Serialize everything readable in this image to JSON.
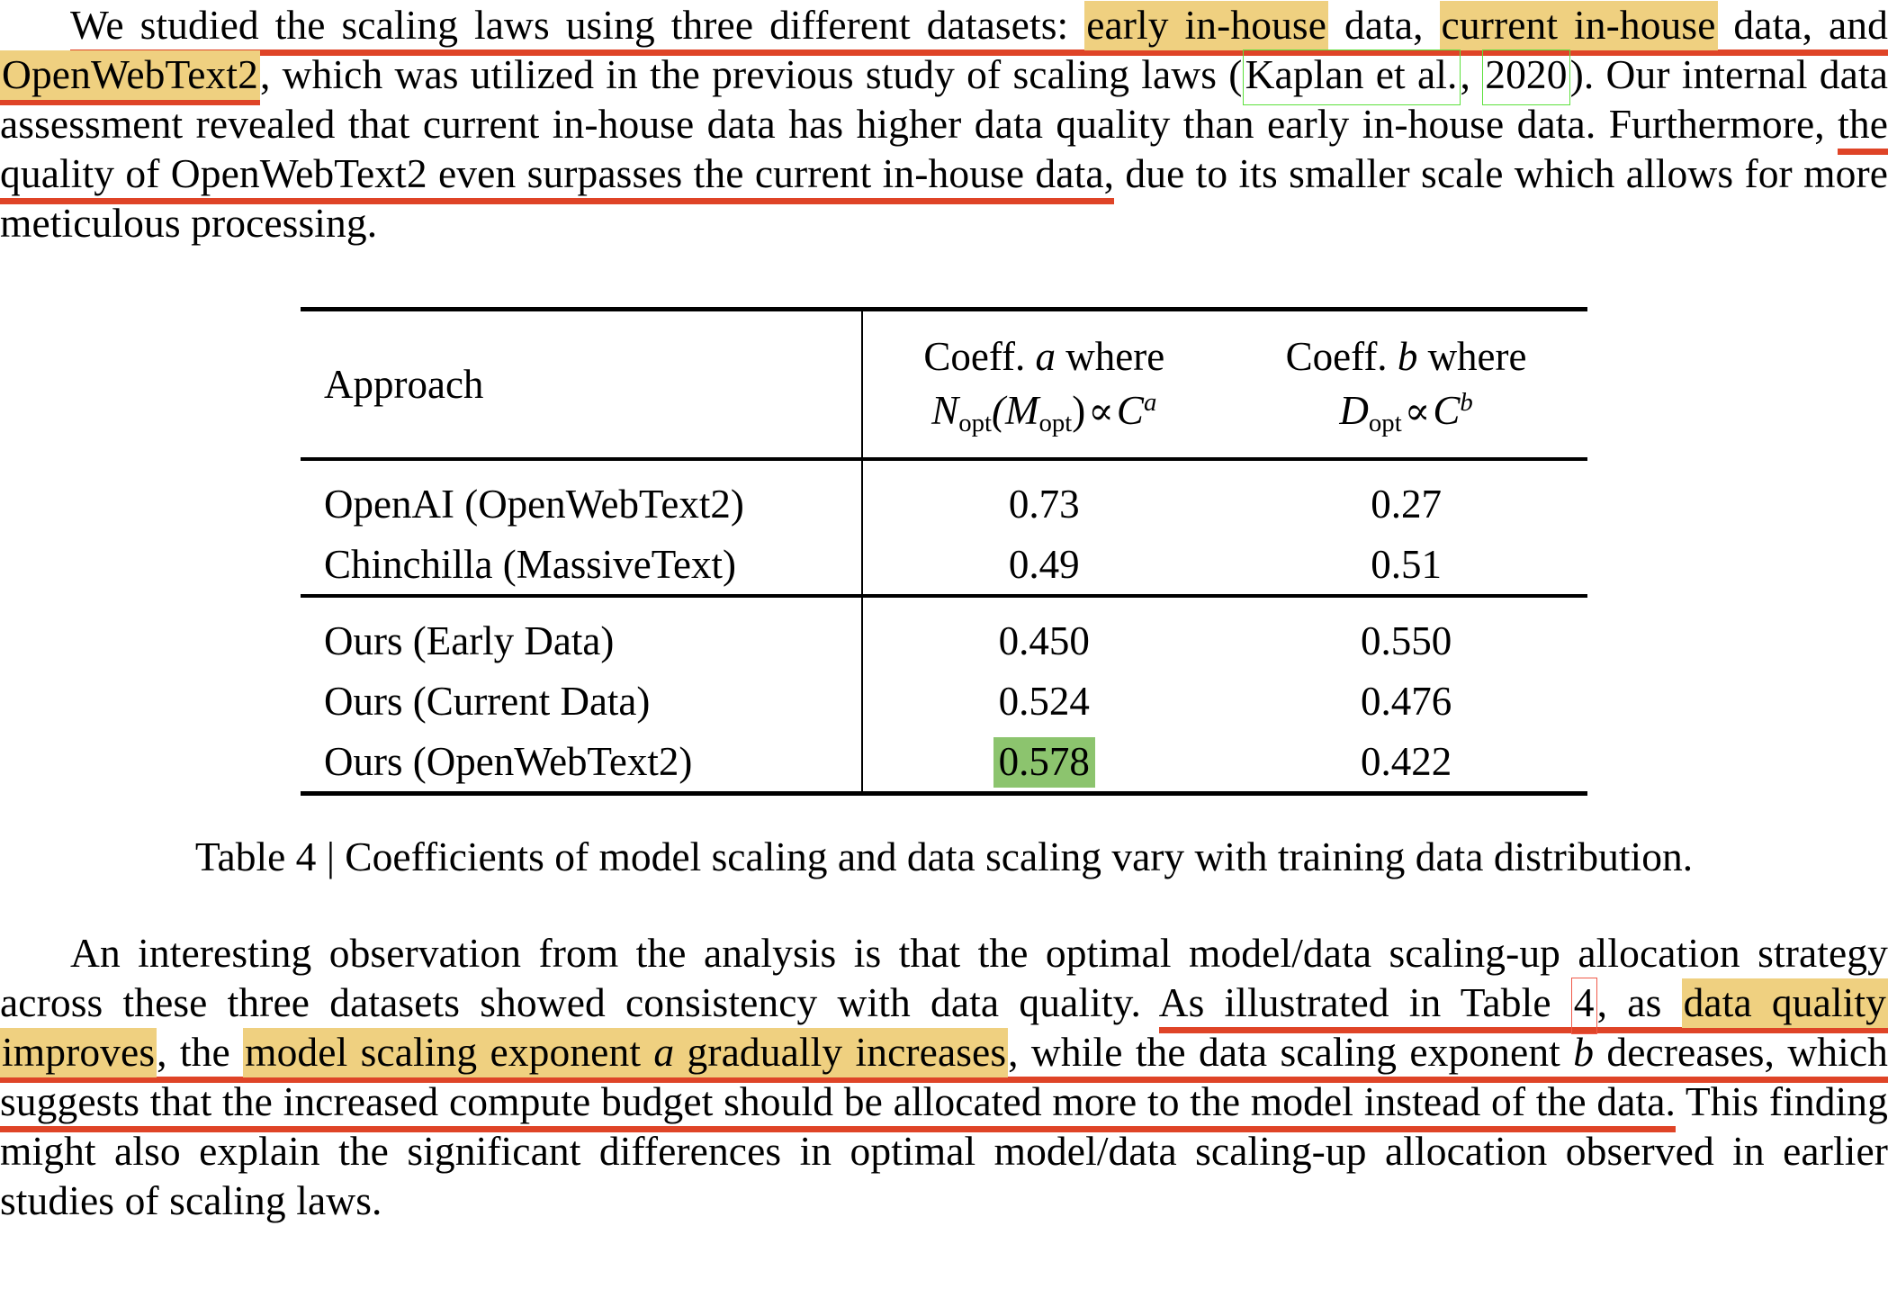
{
  "paragraph_1": {
    "segments": [
      {
        "text": "We studied the scaling laws using three different datasets: ",
        "style": "underline"
      },
      {
        "text": "early in-house",
        "style": "highlight-underline"
      },
      {
        "text": " data, ",
        "style": "underline"
      },
      {
        "text": "current in-house",
        "style": "highlight-underline"
      },
      {
        "text": " data, and ",
        "style": "underline"
      },
      {
        "text": "OpenWebText2",
        "style": "highlight-underline"
      },
      {
        "text": ", which was utilized in the previous study of scaling laws (",
        "style": "plain"
      },
      {
        "text": "Kaplan et al.",
        "style": "cite-box"
      },
      {
        "text": ", ",
        "style": "plain"
      },
      {
        "text": "2020",
        "style": "cite-box"
      },
      {
        "text": "). Our internal data assessment revealed that current in-house data has higher data quality than early in-house data. Furthermore, ",
        "style": "plain"
      },
      {
        "text": "the quality of OpenWebText2 even surpasses the current in-house data,",
        "style": "underline"
      },
      {
        "text": " due to its smaller scale which allows for more meticulous processing.",
        "style": "plain"
      }
    ],
    "plain_text": "We studied the scaling laws using three different datasets: early in-house data, current in-house data, and OpenWebText2, which was utilized in the previous study of scaling laws (Kaplan et al., 2020). Our internal data assessment revealed that current in-house data has higher data quality than early in-house data. Furthermore, the quality of OpenWebText2 even surpasses the current in-house data, due to its smaller scale which allows for more meticulous processing."
  },
  "table": {
    "headers": {
      "approach": "Approach",
      "coeff_a_line1": "Coeff. a where",
      "coeff_a_line2_N": "N",
      "coeff_a_line2_Nsub": "opt",
      "coeff_a_line2_Mopen": "(M",
      "coeff_a_line2_Msub": "opt",
      "coeff_a_line2_Mclose": ")",
      "coeff_a_line2_prop": "∝",
      "coeff_a_line2_C": "C",
      "coeff_a_line2_Csup": "a",
      "coeff_b_line1": "Coeff. b where",
      "coeff_b_line2_D": "D",
      "coeff_b_line2_Dsub": "opt",
      "coeff_b_line2_prop": "∝",
      "coeff_b_line2_C": "C",
      "coeff_b_line2_Csup": "b"
    },
    "group_1": [
      {
        "approach": "OpenAI (OpenWebText2)",
        "coeff_a": "0.73",
        "coeff_b": "0.27"
      },
      {
        "approach": "Chinchilla (MassiveText)",
        "coeff_a": "0.49",
        "coeff_b": "0.51"
      }
    ],
    "group_2": [
      {
        "approach": "Ours (Early Data)",
        "coeff_a": "0.450",
        "coeff_b": "0.550",
        "highlight_a": false
      },
      {
        "approach": "Ours (Current Data)",
        "coeff_a": "0.524",
        "coeff_b": "0.476",
        "highlight_a": false
      },
      {
        "approach": "Ours (OpenWebText2)",
        "coeff_a": "0.578",
        "coeff_b": "0.422",
        "highlight_a": true
      }
    ]
  },
  "caption": {
    "label": "Table 4",
    "separator": "|",
    "text": "Coefficients of model scaling and data scaling vary with training data distribution.",
    "full": "Table 4 | Coefficients of model scaling and data scaling vary with training data distribution."
  },
  "paragraph_2": {
    "segments": [
      {
        "text": "An interesting observation from the analysis is that the optimal model/data scaling-up allocation strategy across these three datasets showed consistency with data quality. ",
        "style": "plain"
      },
      {
        "text": "As illustrated in Table ",
        "style": "underline"
      },
      {
        "text": "4",
        "style": "ref-box-underline"
      },
      {
        "text": ", as ",
        "style": "underline"
      },
      {
        "text": "data quality improves",
        "style": "highlight-underline"
      },
      {
        "text": ", the ",
        "style": "underline"
      },
      {
        "text": "model scaling exponent a gradually increases",
        "style": "highlight-underline"
      },
      {
        "text": ", while the data scaling exponent b decreases, which suggests that the increased compute budget should be allocated more to the model instead of the data.",
        "style": "underline"
      },
      {
        "text": " This finding might also explain the significant differences in optimal model/data scaling-up allocation observed in earlier studies of scaling laws.",
        "style": "plain"
      }
    ],
    "plain_text": "An interesting observation from the analysis is that the optimal model/data scaling-up allocation strategy across these three datasets showed consistency with data quality. As illustrated in Table 4, as data quality improves, the model scaling exponent a gradually increases, while the data scaling exponent b decreases, which suggests that the increased compute budget should be allocated more to the model instead of the data. This finding might also explain the significant differences in optimal model/data scaling-up allocation observed in earlier studies of scaling laws."
  },
  "annotation_colors": {
    "highlight_yellow": "#efd080",
    "underline_red": "#df4427",
    "citation_box_green": "#5ce03c",
    "reference_box_red": "#f05a4a",
    "cell_highlight_green": "#8cc46e"
  },
  "paragraph_1_parts": {
    "p1_a": "We studied the scaling laws using three different datasets: ",
    "p1_hl1": "early in-house",
    "p1_b": " data, ",
    "p1_hl2": "current in-house",
    "p1_c": " data, and ",
    "p1_hl3": "OpenWebText2",
    "p1_d": ", which was utilized in the previous study of scaling laws (",
    "p1_cite1": "Kaplan et al.",
    "p1_comma": ", ",
    "p1_cite2": "2020",
    "p1_e": "). Our internal data assessment revealed that current in-house data has higher data quality than early in-house data. Furthermore, ",
    "p1_ul": "the quality of OpenWebText2 even surpasses the current in-house data,",
    "p1_f": " due to its smaller scale which allows for more meticulous processing."
  },
  "paragraph_2_parts": {
    "p2_a": "An interesting observation from the analysis is that the optimal model/data scaling-up allocation strategy across these three datasets showed consistency with data quality. ",
    "p2_ul1": "As illustrated in Table ",
    "p2_ref": "4",
    "p2_ul2": ", as ",
    "p2_hl1": "data quality improves",
    "p2_ul3": ", the ",
    "p2_hl2a": "model scaling exponent ",
    "p2_hl2b": "a",
    "p2_hl2c": " gradually increases",
    "p2_ul4a": ", while the data scaling exponent ",
    "p2_ul4b": "b",
    "p2_ul4c": " decreases, which suggests that the increased compute budget should be allocated more to the model instead of the data.",
    "p2_f": " This finding might also explain the significant differences in optimal model/data scaling-up allocation observed in earlier studies of scaling laws."
  }
}
